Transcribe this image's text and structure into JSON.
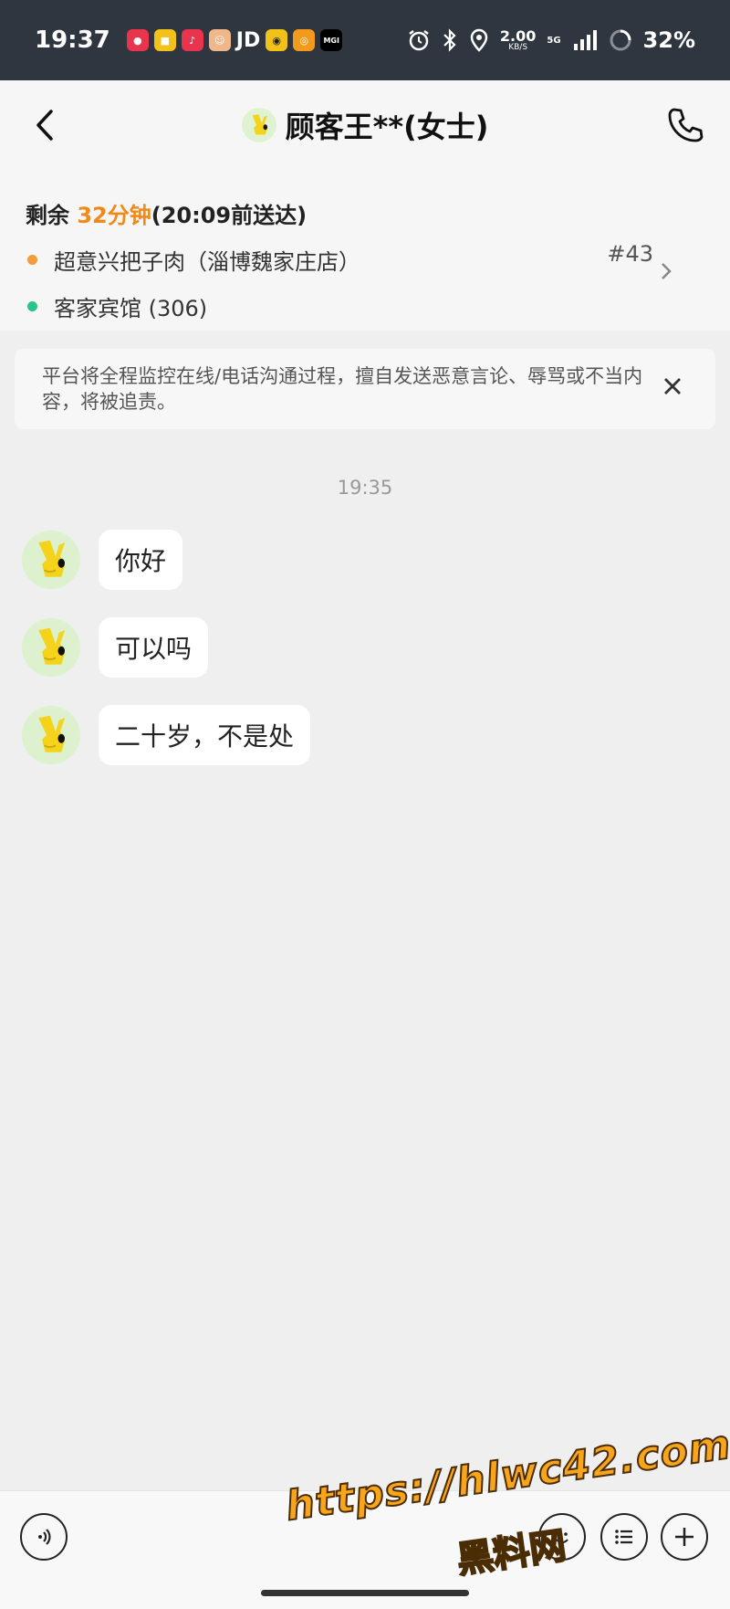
{
  "status_bar": {
    "time": "19:37",
    "apps": [
      "JD"
    ],
    "speed_value": "2.00",
    "speed_unit": "KB/S",
    "network": "5G",
    "battery": "32%"
  },
  "header": {
    "title": "顾客王**(女士)"
  },
  "order": {
    "remaining_prefix": "剩余 ",
    "remaining_time": "32分钟",
    "deliver_by": "(20:09前送达)",
    "store": "超意兴把子肉（淄博魏家庄店）",
    "destination": "客家宾馆 (306)",
    "order_number": "#43"
  },
  "notice": {
    "text": "平台将全程监控在线/电话沟通过程，擅自发送恶意言论、辱骂或不当内容，将被追责。"
  },
  "chat": {
    "timestamp": "19:35",
    "messages": [
      {
        "text": "你好"
      },
      {
        "text": "可以吗"
      },
      {
        "text": "二十岁，不是处"
      }
    ]
  },
  "watermark": {
    "line1": "https://hlwc42.com",
    "line2": "黑料网"
  }
}
